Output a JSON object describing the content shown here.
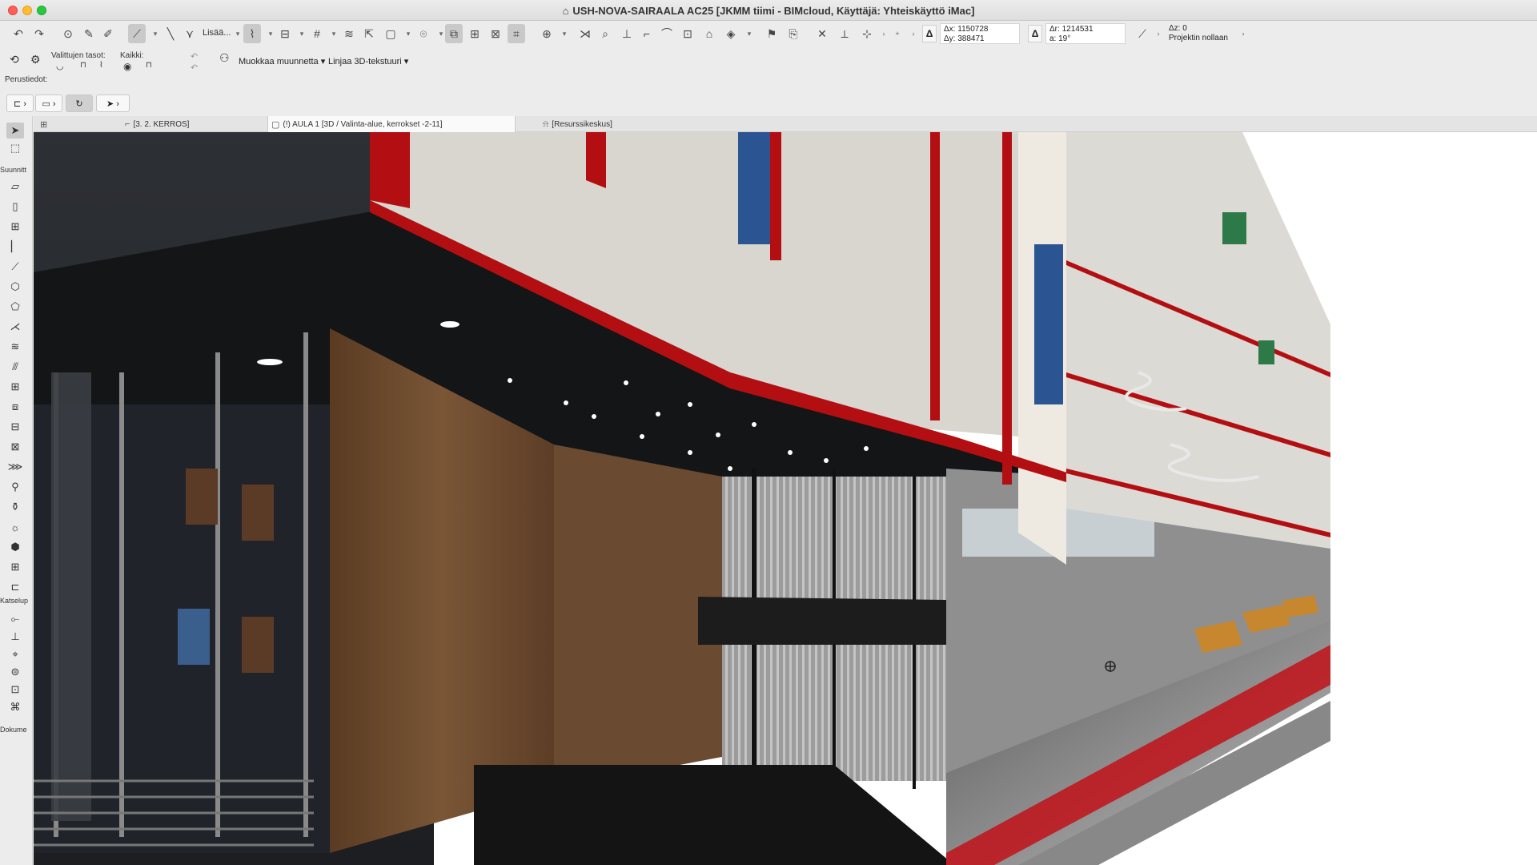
{
  "window": {
    "title": "USH-NOVA-SAIRAALA AC25 [JKMM tiimi - BIMcloud, Käyttäjä: Yhteiskäyttö iMac]"
  },
  "toolbar": {
    "add_label": "Lisää...",
    "coords": {
      "dx_label": "Δx:",
      "dx": "1150728",
      "dy_label": "Δy:",
      "dy": "388471",
      "dr_label": "Δr:",
      "dr": "1214531",
      "a_label": "a:",
      "angle": "19°",
      "dz_label": "Δz:",
      "dz": "0",
      "project_zero": "Projektin nollaan"
    }
  },
  "infobox": {
    "selected_layers": "Valittujen tasot:",
    "all": "Kaikki:",
    "basic": "Perustiedot:",
    "edit_transform": "Muokkaa muunnetta",
    "text_style": "Linjaa 3D-tekstuuri"
  },
  "tabs": [
    {
      "label": "[3. 2. KERROS]"
    },
    {
      "label": "(!) AULA 1 [3D / Valinta-alue, kerrokset -2-11]"
    },
    {
      "label": "[Resurssikeskus]"
    }
  ],
  "toolbox": {
    "design": "Suunnitt",
    "view": "Katselup",
    "document": "Dokume"
  },
  "colors": {
    "accent_red": "#b30f12",
    "dark_floor": "#1b1c1e",
    "wood": "#6b4a30",
    "glass_gray": "#b9b9b9"
  }
}
